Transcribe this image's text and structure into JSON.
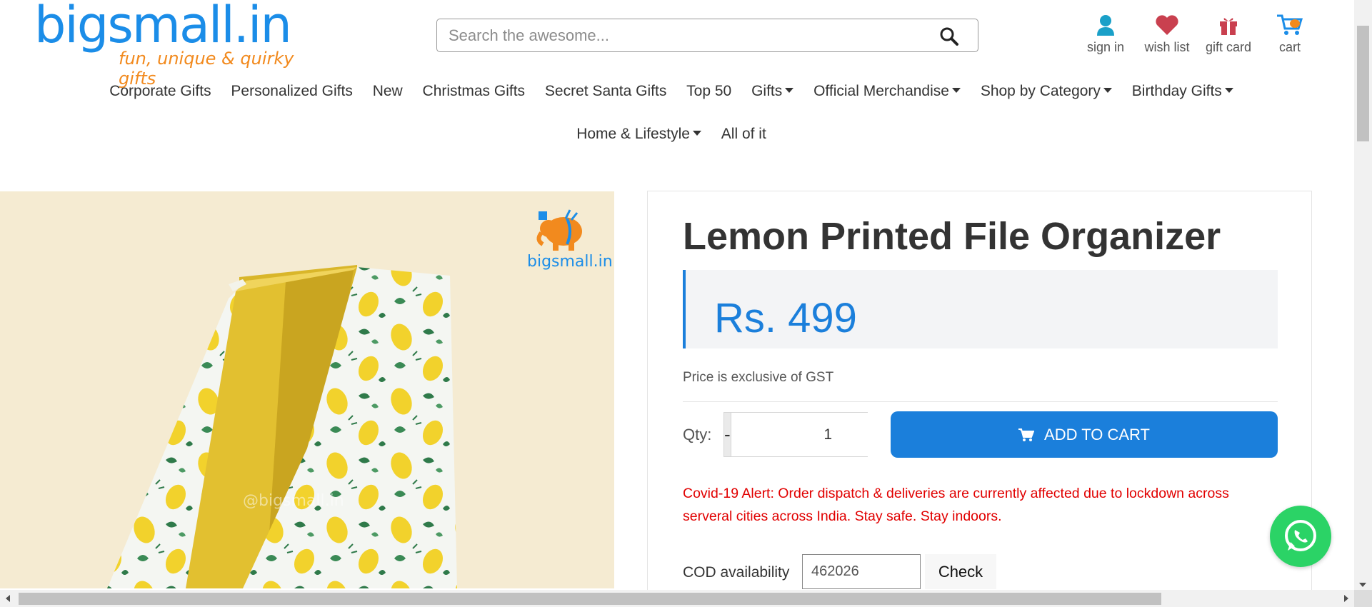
{
  "brand": {
    "name": "bigsmall.in",
    "tagline": "fun, unique & quirky gifts",
    "color_primary": "#1b8de8",
    "color_secondary": "#f28a1e"
  },
  "search": {
    "placeholder": "Search the awesome...",
    "icon": "search-icon"
  },
  "header_links": [
    {
      "label": "sign in",
      "icon": "user-icon",
      "color": "#1aa0c8"
    },
    {
      "label": "wish list",
      "icon": "heart-icon",
      "color": "#c9404f"
    },
    {
      "label": "gift card",
      "icon": "gift-icon",
      "color": "#c9404f"
    },
    {
      "label": "cart",
      "icon": "cart-icon",
      "color": "#1b8de8"
    }
  ],
  "nav": {
    "row1": [
      {
        "label": "Corporate Gifts",
        "dropdown": false
      },
      {
        "label": "Personalized Gifts",
        "dropdown": false
      },
      {
        "label": "New",
        "dropdown": false
      },
      {
        "label": "Christmas Gifts",
        "dropdown": false
      },
      {
        "label": "Secret Santa Gifts",
        "dropdown": false
      },
      {
        "label": "Top 50",
        "dropdown": false
      },
      {
        "label": "Gifts",
        "dropdown": true
      },
      {
        "label": "Official Merchandise",
        "dropdown": true
      },
      {
        "label": "Shop by Category",
        "dropdown": true
      },
      {
        "label": "Birthday Gifts",
        "dropdown": true
      }
    ],
    "row2": [
      {
        "label": "Home & Lifestyle",
        "dropdown": true
      },
      {
        "label": "All of it",
        "dropdown": false
      }
    ]
  },
  "product": {
    "title": "Lemon Printed File Organizer",
    "price": "Rs. 499",
    "tax_note": "Price is exclusive of GST",
    "qty_label": "Qty:",
    "qty_minus": "-",
    "qty_value": "1",
    "qty_plus": "+",
    "add_to_cart": "ADD TO CART",
    "alert": "Covid-19 Alert: Order dispatch & deliveries are currently affected due to lockdown across serveral cities across India. Stay safe. Stay indoors.",
    "cod_label": "COD availability",
    "cod_pincode": "462026",
    "cod_check": "Check",
    "accent_color": "#1b7fdb",
    "alert_color": "#e10000"
  },
  "product_image": {
    "watermark_text": "bigsmall.in"
  },
  "whatsapp": {
    "icon": "whatsapp-icon",
    "color": "#2bd366"
  }
}
